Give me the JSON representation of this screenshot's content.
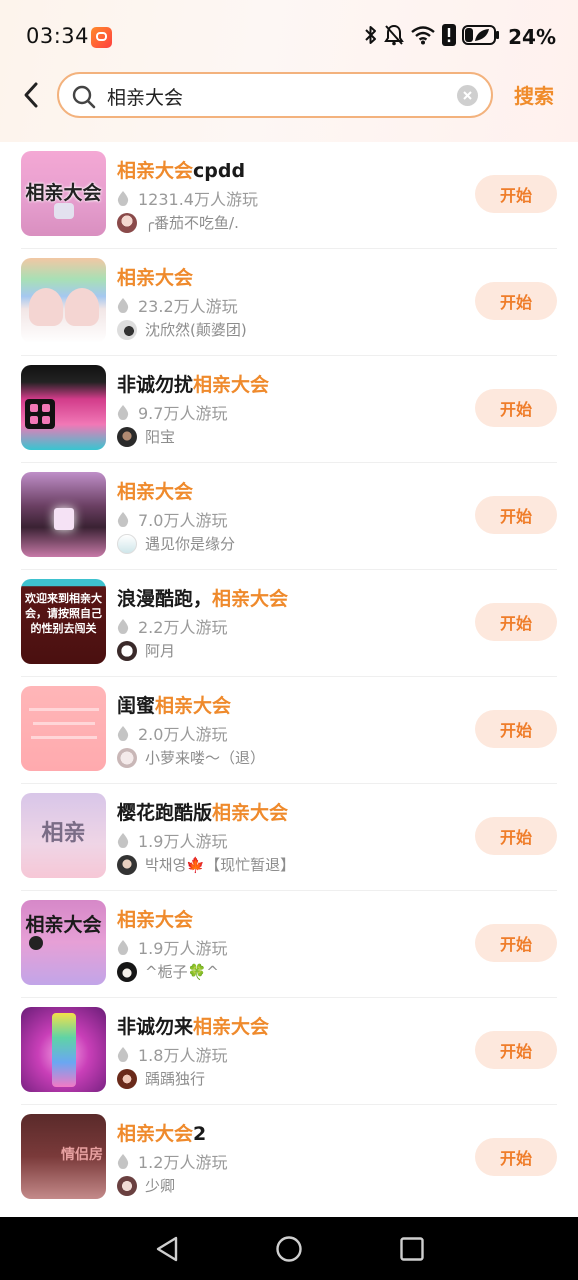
{
  "status_bar": {
    "time": "03:34",
    "battery": "24%",
    "icons": [
      "bluetooth-icon",
      "mute-icon",
      "wifi-icon",
      "alert-icon",
      "battery-icon"
    ]
  },
  "header": {
    "back_icon": "chevron-left-icon",
    "search_value": "相亲大会",
    "search_placeholder": "",
    "search_button": "搜索"
  },
  "colors": {
    "accent": "#ef8a2c",
    "button_bg": "#fde8dd",
    "search_border": "#f3b27d"
  },
  "results": [
    {
      "title_pre": "",
      "title_hl": "相亲大会",
      "title_post": "cpdd",
      "plays": "1231.4万人游玩",
      "author": "╭番茄不吃鱼/.",
      "thumb_text": "相亲大会",
      "button": "开始"
    },
    {
      "title_pre": "",
      "title_hl": "相亲大会",
      "title_post": "",
      "plays": "23.2万人游玩",
      "author": "沈欣然(颠婆团)",
      "thumb_text": "",
      "button": "开始"
    },
    {
      "title_pre": "非诚勿扰",
      "title_hl": "相亲大会",
      "title_post": "",
      "plays": "9.7万人游玩",
      "author": "阳宝",
      "thumb_text": "",
      "button": "开始"
    },
    {
      "title_pre": "",
      "title_hl": "相亲大会",
      "title_post": "",
      "plays": "7.0万人游玩",
      "author": "遇见你是缘分",
      "thumb_text": "",
      "button": "开始"
    },
    {
      "title_pre": "浪漫酷跑，",
      "title_hl": "相亲大会",
      "title_post": "",
      "plays": "2.2万人游玩",
      "author": "阿月",
      "thumb_text": "欢迎来到相亲大会，请按照自己的性别去闯关",
      "button": "开始"
    },
    {
      "title_pre": "闺蜜",
      "title_hl": "相亲大会",
      "title_post": "",
      "plays": "2.0万人游玩",
      "author": "小萝来喽～（退）",
      "thumb_text": "",
      "button": "开始"
    },
    {
      "title_pre": "樱花跑酷版",
      "title_hl": "相亲大会",
      "title_post": "",
      "plays": "1.9万人游玩",
      "author": "박채영🍁【现忙暂退】",
      "thumb_text": "相亲",
      "button": "开始"
    },
    {
      "title_pre": "",
      "title_hl": "相亲大会",
      "title_post": "",
      "plays": "1.9万人游玩",
      "author": "^栀子🍀^",
      "thumb_text": "相亲大会",
      "button": "开始"
    },
    {
      "title_pre": "非诚勿来",
      "title_hl": "相亲大会",
      "title_post": "",
      "plays": "1.8万人游玩",
      "author": "踽踽独行",
      "thumb_text": "",
      "button": "开始"
    },
    {
      "title_pre": "",
      "title_hl": "相亲大会",
      "title_post": "2",
      "plays": "1.2万人游玩",
      "author": "少卿",
      "thumb_text": "情侣房",
      "button": "开始"
    }
  ],
  "nav": {
    "back": "nav-back-icon",
    "home": "nav-home-icon",
    "recents": "nav-recents-icon"
  }
}
